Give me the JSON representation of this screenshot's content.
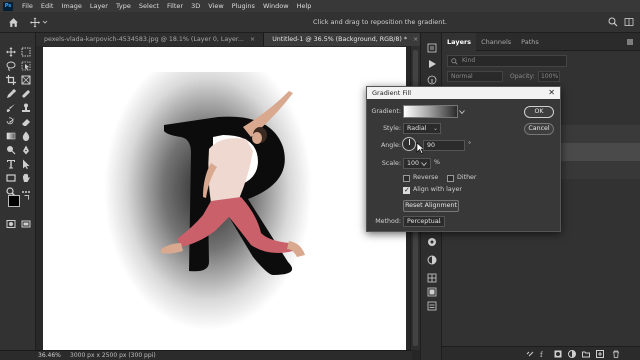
{
  "menubar": {
    "logo": "Ps",
    "items": [
      "File",
      "Edit",
      "Image",
      "Layer",
      "Type",
      "Select",
      "Filter",
      "3D",
      "View",
      "Plugins",
      "Window",
      "Help"
    ]
  },
  "options": {
    "hint": "Click and drag to reposition the gradient."
  },
  "tabs": [
    {
      "label": "pexels-vlada-karpovich-4534583.jpg @ 18.1% (Layer 0, Layer...",
      "close": "×",
      "active": false
    },
    {
      "label": "Untitled-1 @ 36.5% (Background, RGB/8) *",
      "close": "×",
      "active": true
    }
  ],
  "status": {
    "zoom": "36.46%",
    "doc_info": "3000 px x 2500 px (300 ppi)"
  },
  "layers_panel": {
    "tabs": [
      "Layers",
      "Channels",
      "Paths"
    ],
    "kind_placeholder": "Kind",
    "blend_mode": "Normal",
    "opacity_label": "Opacity:",
    "opacity_value": "100%"
  },
  "dialog": {
    "title": "Gradient Fill",
    "close": "✕",
    "gradient_label": "Gradient:",
    "style_label": "Style:",
    "style_value": "Radial",
    "angle_label": "Angle:",
    "angle_value": "90",
    "angle_unit": "°",
    "scale_label": "Scale:",
    "scale_value": "100",
    "scale_unit": "%",
    "reverse_label": "Reverse",
    "reverse_checked": false,
    "dither_label": "Dither",
    "dither_checked": false,
    "align_label": "Align with layer",
    "align_checked": true,
    "reset_label": "Reset Alignment",
    "method_label": "Method:",
    "method_value": "Perceptual",
    "ok_label": "OK",
    "cancel_label": "Cancel"
  },
  "canvas": {
    "letter": "R"
  },
  "colors": {
    "app_bg": "#262626",
    "panel": "#323232",
    "foreground_swatch": "#000000",
    "background_swatch": "#ffffff",
    "leggings": "#c9606a",
    "top": "#efd8cf"
  }
}
